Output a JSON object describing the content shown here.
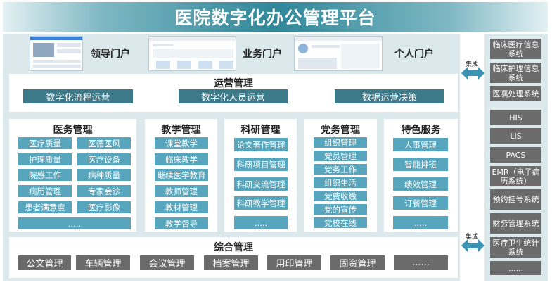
{
  "title": "医院数字化办公管理平台",
  "portals": [
    {
      "label": "领导门户"
    },
    {
      "label": "业务门户"
    },
    {
      "label": "个人门户"
    }
  ],
  "operations": {
    "title": "运营管理",
    "items": [
      "数字化流程运营",
      "数字化人员运营",
      "数据运营决策"
    ]
  },
  "modules": [
    {
      "title": "医务管理",
      "items": [
        "医疗质量",
        "医德医风",
        "护理质量",
        "医疗设备",
        "院感工作",
        "病种质量",
        "病历管理",
        "专家会诊",
        "患者满意度",
        "医疗影像",
        "....."
      ]
    },
    {
      "title": "教学管理",
      "items": [
        "课堂教学",
        "临床教学",
        "继续医学教育",
        "教师管理",
        "教材管理",
        "教学督导"
      ]
    },
    {
      "title": "科研管理",
      "items": [
        "论文著作管理",
        "科研项目管理",
        "科研交流管理",
        "科研教学管理",
        "....."
      ]
    },
    {
      "title": "党务管理",
      "items": [
        "组织管理",
        "党员管理",
        "党务工作",
        "组织生活",
        "党费收缴",
        "党的宣传",
        "党校在线"
      ]
    },
    {
      "title": "特色服务",
      "items": [
        "人事管理",
        "智能排班",
        "绩效管理",
        "订餐管理",
        "....."
      ]
    }
  ],
  "general": {
    "title": "综合管理",
    "items": [
      "公文管理",
      "车辆管理",
      "会议管理",
      "档案管理",
      "用印管理",
      "固资管理",
      "......"
    ]
  },
  "integration_label": "集成",
  "systems": [
    "临床医疗信息系统",
    "临床护理信息系统",
    "医嘱处理系统",
    "HIS",
    "LIS",
    "PACS",
    "EMR（电子病历系统）",
    "预约挂号系统",
    "财务管理系统",
    "医疗卫生统计系统",
    "......"
  ],
  "colors": {
    "dark_teal": "#3c7a8a",
    "light_teal": "#58a6bd",
    "gray": "#6b6b6b",
    "panel": "#dbe9ec"
  }
}
